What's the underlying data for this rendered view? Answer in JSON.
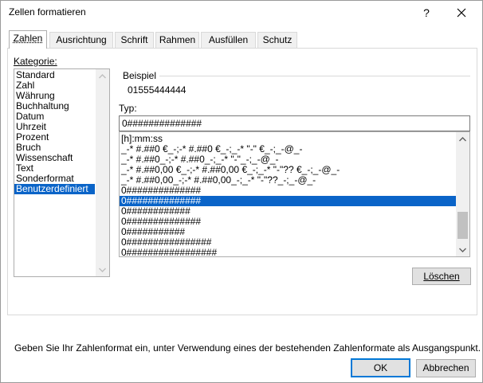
{
  "window": {
    "title": "Zellen formatieren",
    "help_label": "?"
  },
  "tabs": [
    {
      "label": "Zahlen",
      "active": true
    },
    {
      "label": "Ausrichtung",
      "active": false
    },
    {
      "label": "Schrift",
      "active": false
    },
    {
      "label": "Rahmen",
      "active": false
    },
    {
      "label": "Ausfüllen",
      "active": false
    },
    {
      "label": "Schutz",
      "active": false
    }
  ],
  "category": {
    "label": "Kategorie:",
    "items": [
      "Standard",
      "Zahl",
      "Währung",
      "Buchhaltung",
      "Datum",
      "Uhrzeit",
      "Prozent",
      "Bruch",
      "Wissenschaft",
      "Text",
      "Sonderformat",
      "Benutzerdefiniert"
    ],
    "selected_index": 11
  },
  "sample": {
    "label": "Beispiel",
    "value": "01555444444"
  },
  "type": {
    "label": "Typ:",
    "value": "0##############"
  },
  "formats": {
    "items": [
      "[h]:mm:ss",
      "_-* #.##0 €_-;-* #.##0 €_-;_-* \"-\" €_-;_-@_-",
      "_-* #.##0_-;-* #.##0_-;_-* \"-\"_-;_-@_-",
      "_-* #.##0,00 €_-;-* #.##0,00 €_-;_-* \"-\"?? €_-;_-@_-",
      "_-* #.##0,00_-;-* #.##0,00_-;_-* \"-\"??_-;_-@_-",
      "0##############",
      "0##############",
      "0############",
      "0##############",
      "0###########",
      "0################",
      "0#################"
    ],
    "selected_index": 6
  },
  "buttons": {
    "delete": "Löschen",
    "ok": "OK",
    "cancel": "Abbrechen"
  },
  "description": "Geben Sie Ihr Zahlenformat ein, unter Verwendung eines der bestehenden Zahlenformate als Ausgangspunkt.",
  "colors": {
    "selection": "#0a64c8",
    "default_button_border": "#0078d7"
  }
}
